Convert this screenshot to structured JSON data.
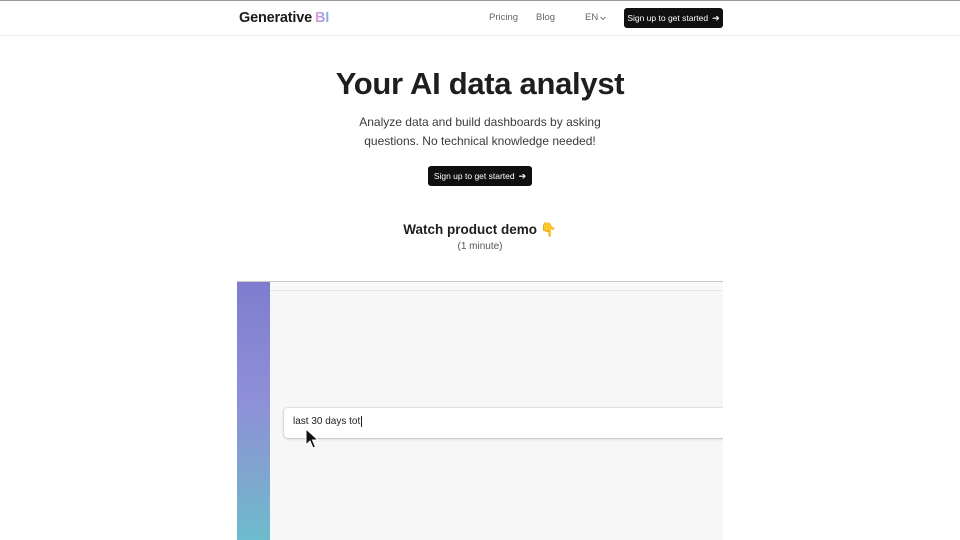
{
  "header": {
    "logo_main": "Generative",
    "logo_accent": "BI",
    "nav": {
      "pricing": "Pricing",
      "blog": "Blog"
    },
    "language": "EN",
    "cta_label": "Sign up to get started"
  },
  "hero": {
    "title": "Your AI data analyst",
    "subtitle": "Analyze data and build dashboards by asking questions. No technical knowledge needed!",
    "cta_label": "Sign up to get started"
  },
  "demo": {
    "title": "Watch product demo",
    "hand_emoji": "👇",
    "subtitle": "(1 minute)",
    "query_text": "last 30 days tot"
  },
  "colors": {
    "button_bg": "#101010",
    "sidebar_top": "#7f7ccf",
    "sidebar_bottom": "#6dbccd"
  },
  "icons": {
    "cta_arrow": "arrow-right-icon",
    "lang_chevron": "chevron-down-icon",
    "pointer": "mouse-pointer-icon"
  }
}
